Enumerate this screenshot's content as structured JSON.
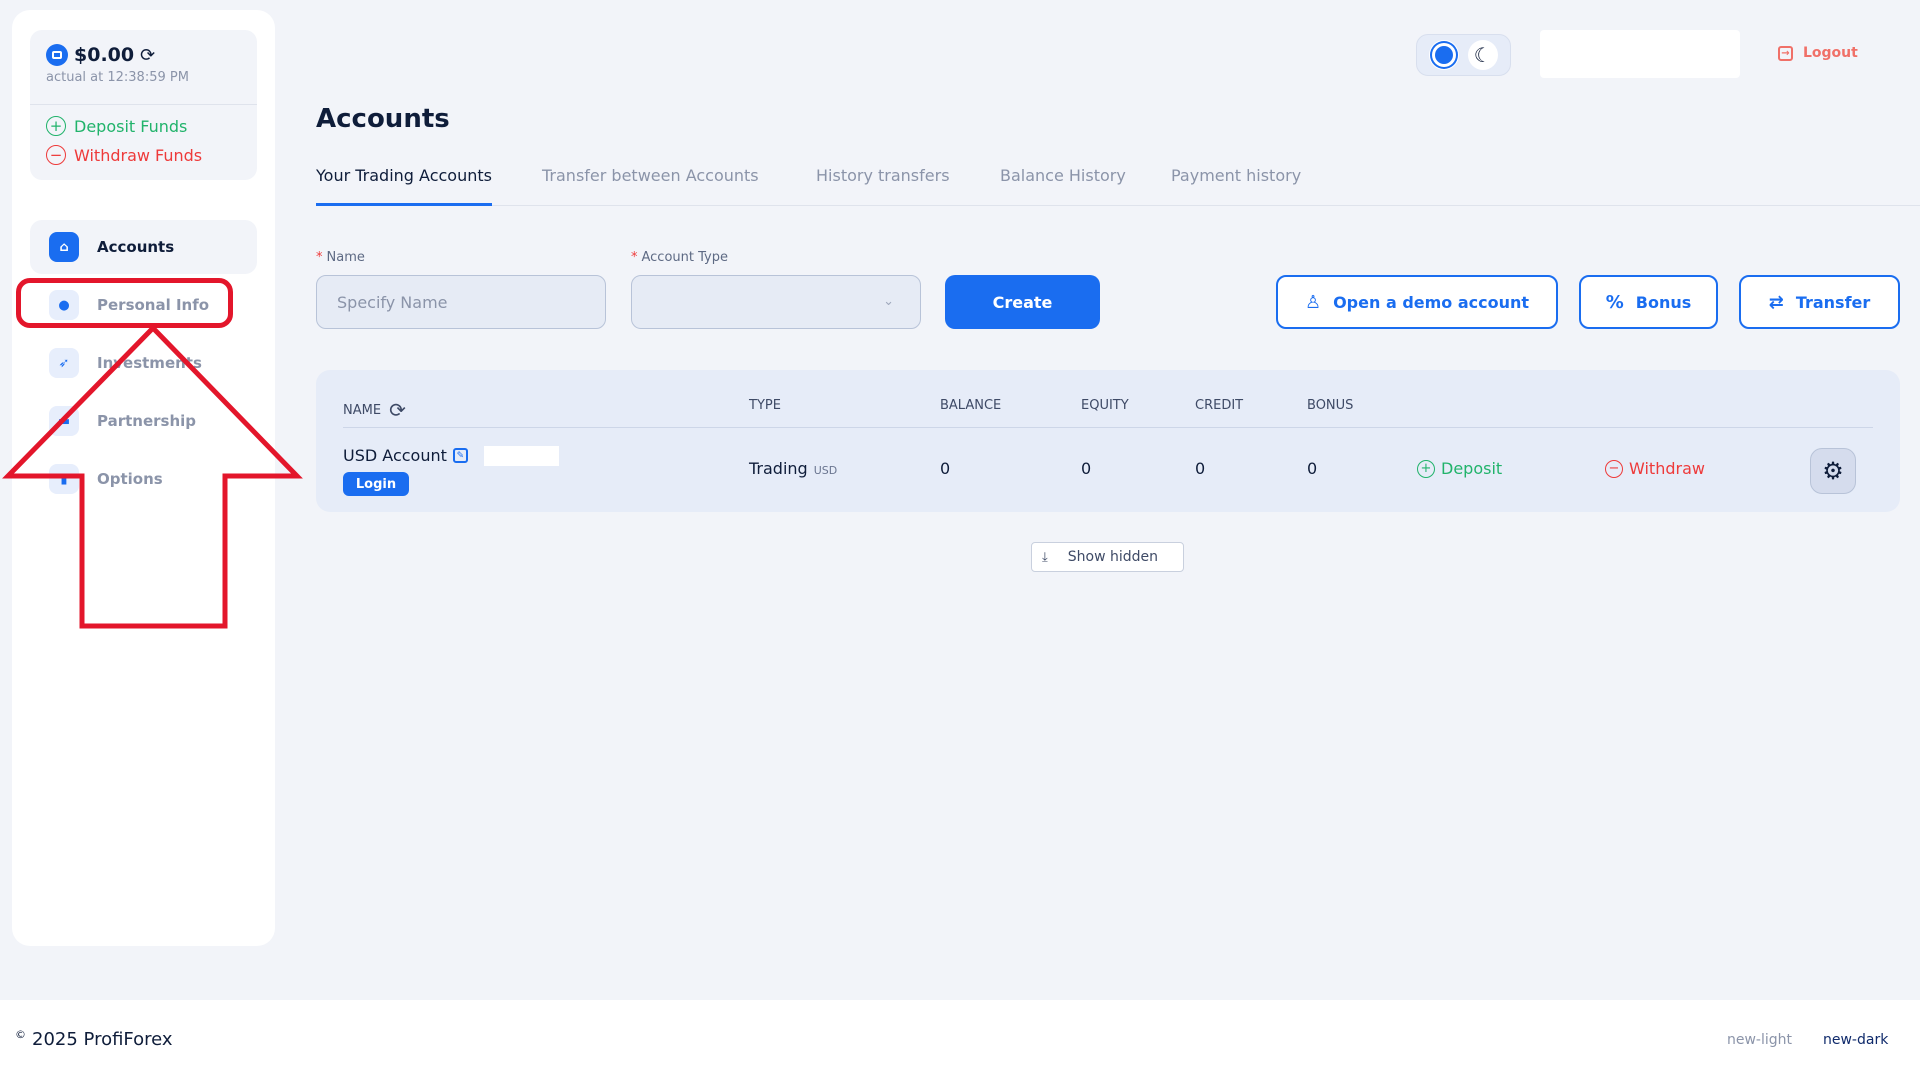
{
  "wallet": {
    "balance": "$0.00",
    "actual": "actual at 12:38:59 PM",
    "deposit": "Deposit Funds",
    "withdraw": "Withdraw Funds"
  },
  "nav": {
    "items": [
      {
        "label": "Accounts",
        "icon": "home-icon"
      },
      {
        "label": "Personal Info",
        "icon": "user-icon"
      },
      {
        "label": "Investments",
        "icon": "rocket-icon"
      },
      {
        "label": "Partnership",
        "icon": "handshake-icon"
      },
      {
        "label": "Options",
        "icon": "chart-icon"
      }
    ]
  },
  "header": {
    "logout": "Logout"
  },
  "page": {
    "title": "Accounts",
    "tabs": [
      "Your Trading Accounts",
      "Transfer between Accounts",
      "History transfers",
      "Balance History",
      "Payment history"
    ]
  },
  "form": {
    "name_label": "Name",
    "name_placeholder": "Specify Name",
    "type_label": "Account Type",
    "required_mark": "*",
    "create": "Create",
    "demo": "Open a demo account",
    "bonus": "Bonus",
    "transfer": "Transfer"
  },
  "table": {
    "headers": {
      "name": "NAME",
      "type": "TYPE",
      "balance": "BALANCE",
      "equity": "EQUITY",
      "credit": "CREDIT",
      "bonus": "BONUS"
    },
    "row": {
      "name": "USD Account",
      "login": "Login",
      "type": "Trading",
      "currency": "USD",
      "balance": "0",
      "equity": "0",
      "credit": "0",
      "bonus": "0",
      "deposit": "Deposit",
      "withdraw": "Withdraw"
    },
    "show_hidden": "Show hidden"
  },
  "footer": {
    "copyright_mark": "©",
    "copyright": "2025 ProfiForex",
    "theme_light": "new-light",
    "theme_dark": "new-dark"
  },
  "colors": {
    "accent": "#1a6df0",
    "success": "#21b36b",
    "danger": "#ee3a3a",
    "annotation": "#e3162b"
  }
}
